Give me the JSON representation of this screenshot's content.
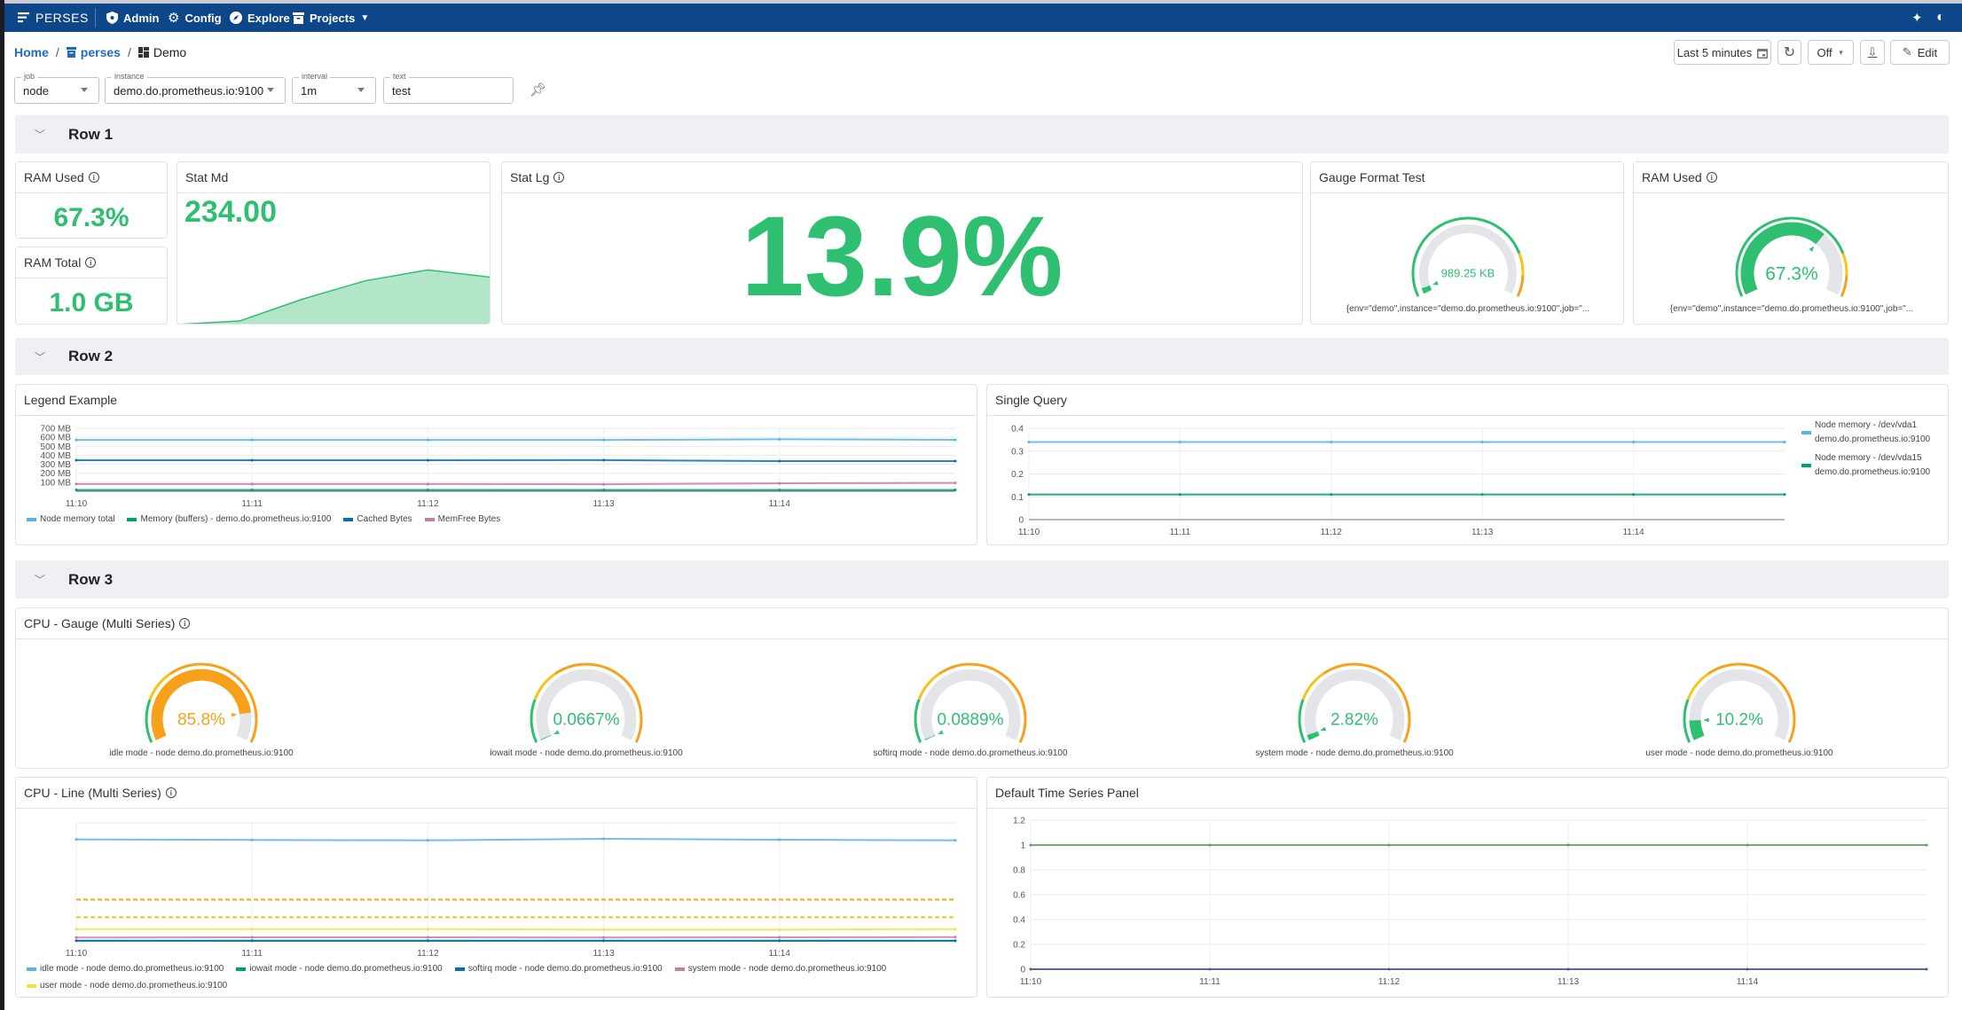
{
  "nav": {
    "brand": "PERSES",
    "items": [
      {
        "label": "Admin",
        "icon": "shield-icon"
      },
      {
        "label": "Config",
        "icon": "gear-icon"
      },
      {
        "label": "Explore",
        "icon": "compass-icon"
      },
      {
        "label": "Projects",
        "icon": "archive-icon"
      }
    ]
  },
  "breadcrumb": {
    "home": "Home",
    "project": "perses",
    "dashboard": "Demo"
  },
  "variables": [
    {
      "label": "job",
      "value": "node",
      "type": "select"
    },
    {
      "label": "instance",
      "value": "demo.do.prometheus.io:9100",
      "type": "select"
    },
    {
      "label": "interval",
      "value": "1m",
      "type": "select"
    },
    {
      "label": "text",
      "value": "test",
      "type": "text"
    }
  ],
  "toolbar": {
    "time_range": "Last 5 minutes",
    "refresh_interval": "Off",
    "edit_label": "Edit"
  },
  "colors": {
    "nav": "#0e4789",
    "green": "#2fbf71",
    "yellow": "#f6c417",
    "orange": "#f7a11a",
    "gauge_track": "#e3e5e8"
  },
  "rows": [
    {
      "title": "Row 1"
    },
    {
      "title": "Row 2"
    },
    {
      "title": "Row 3"
    }
  ],
  "row1": {
    "ram_used": {
      "title": "RAM Used",
      "value": "67.3%"
    },
    "ram_total": {
      "title": "RAM Total",
      "value": "1.0 GB"
    },
    "stat_md": {
      "title": "Stat Md",
      "value": "234.00",
      "sparkline": [
        0,
        0.03,
        0.21,
        0.36,
        0.45,
        0.39
      ]
    },
    "stat_lg": {
      "title": "Stat Lg",
      "value": "13.9%"
    },
    "gauge_format": {
      "title": "Gauge Format Test"
    },
    "ram_used_gauge": {
      "title": "RAM Used"
    }
  },
  "gauges": {
    "gauge_format": {
      "value": "989.25 KB",
      "fraction": 0.03,
      "label": "{env=\"demo\",instance=\"demo.do.prometheus.io:9100\",job=\"...",
      "thresholds": [
        {
          "from": 0,
          "color": "#2fbf71"
        },
        {
          "from": 0.8,
          "color": "#f6c417"
        },
        {
          "from": 0.9,
          "color": "#f7a11a"
        }
      ]
    },
    "ram_used": {
      "value": "67.3%",
      "fraction": 0.673,
      "label": "{env=\"demo\",instance=\"demo.do.prometheus.io:9100\",job=\"...",
      "thresholds": [
        {
          "from": 0,
          "color": "#2fbf71"
        },
        {
          "from": 0.8,
          "color": "#f6c417"
        },
        {
          "from": 0.9,
          "color": "#f7a11a"
        }
      ]
    },
    "cpu_title": "CPU - Gauge (Multi Series)",
    "cpu": [
      {
        "value": "85.8%",
        "fraction": 0.858,
        "label": "idle mode - node demo.do.prometheus.io:9100"
      },
      {
        "value": "0.0667%",
        "fraction": 0.000667,
        "label": "iowait mode - node demo.do.prometheus.io:9100"
      },
      {
        "value": "0.0889%",
        "fraction": 0.000889,
        "label": "softirq mode - node demo.do.prometheus.io:9100"
      },
      {
        "value": "2.82%",
        "fraction": 0.0282,
        "label": "system mode - node demo.do.prometheus.io:9100"
      },
      {
        "value": "10.2%",
        "fraction": 0.102,
        "label": "user mode - node demo.do.prometheus.io:9100"
      }
    ],
    "cpu_thresholds": [
      {
        "from": 0,
        "color": "#2fbf71"
      },
      {
        "from": 0.2,
        "color": "#f6c417"
      },
      {
        "from": 0.35,
        "color": "#f7a11a"
      }
    ]
  },
  "chart_data": [
    {
      "id": "legend_example",
      "title": "Legend Example",
      "type": "line",
      "x": [
        "11:10",
        "11:11",
        "11:12",
        "11:13",
        "11:14",
        "11:15"
      ],
      "xticks": [
        "11:10",
        "11:11",
        "11:12",
        "11:13",
        "11:14"
      ],
      "yticks": [
        100,
        200,
        300,
        400,
        500,
        600,
        700
      ],
      "ytick_labels": [
        "100 MB",
        "200 MB",
        "300 MB",
        "400 MB",
        "500 MB",
        "600 MB",
        "700 MB"
      ],
      "ylim": [
        0,
        700
      ],
      "yunit": "MB",
      "legend": "bottom",
      "grid": true,
      "series": [
        {
          "name": "Node memory total",
          "color": "#56b4e9",
          "values": [
            570,
            570,
            570,
            570,
            578,
            572
          ]
        },
        {
          "name": "Memory (buffers) - demo.do.prometheus.io:9100",
          "color": "#009e73",
          "values": [
            15,
            15,
            15,
            15,
            15,
            15
          ]
        },
        {
          "name": "Cached Bytes",
          "color": "#0072b2",
          "values": [
            345,
            345,
            345,
            346,
            335,
            335
          ]
        },
        {
          "name": "MemFree Bytes",
          "color": "#cc79a7",
          "values": [
            80,
            80,
            80,
            78,
            88,
            92
          ]
        }
      ]
    },
    {
      "id": "single_query",
      "title": "Single Query",
      "type": "line",
      "x": [
        "11:10",
        "11:11",
        "11:12",
        "11:13",
        "11:14",
        "11:15"
      ],
      "xticks": [
        "11:10",
        "11:11",
        "11:12",
        "11:13",
        "11:14"
      ],
      "yticks": [
        0,
        0.1,
        0.2,
        0.3,
        0.4
      ],
      "ytick_labels": [
        "0",
        "0.1",
        "0.2",
        "0.3",
        "0.4"
      ],
      "ylim": [
        0,
        0.4
      ],
      "legend": "right",
      "grid": true,
      "series": [
        {
          "name": "Node memory - /dev/vda1",
          "name2": "demo.do.prometheus.io:9100",
          "color": "#56b4e9",
          "values": [
            0.34,
            0.34,
            0.34,
            0.34,
            0.34,
            0.34
          ]
        },
        {
          "name": "Node memory - /dev/vda15",
          "name2": "demo.do.prometheus.io:9100",
          "color": "#009e73",
          "values": [
            0.11,
            0.11,
            0.11,
            0.11,
            0.11,
            0.11
          ]
        }
      ]
    },
    {
      "id": "cpu_line",
      "title": "CPU - Line (Multi Series)",
      "type": "line",
      "x": [
        "11:10",
        "11:11",
        "11:12",
        "11:13",
        "11:14",
        "11:15"
      ],
      "xticks": [
        "11:10",
        "11:11",
        "11:12",
        "11:13",
        "11:14"
      ],
      "yticks": [],
      "ytick_labels": [],
      "ylim": [
        0,
        1
      ],
      "legend": "bottom",
      "grid": true,
      "thresholds": [
        {
          "value": 0.35,
          "color": "#f7a11a"
        },
        {
          "value": 0.2,
          "color": "#f6c417"
        }
      ],
      "series": [
        {
          "name": "idle mode - node demo.do.prometheus.io:9100",
          "color": "#56b4e9",
          "values": [
            0.86,
            0.855,
            0.852,
            0.865,
            0.857,
            0.852
          ]
        },
        {
          "name": "iowait mode - node demo.do.prometheus.io:9100",
          "color": "#009e73",
          "values": [
            0.0007,
            0.0007,
            0.0007,
            0.0007,
            0.0007,
            0.0007
          ]
        },
        {
          "name": "softirq mode - node demo.do.prometheus.io:9100",
          "color": "#0072b2",
          "values": [
            0.0009,
            0.0009,
            0.0009,
            0.0009,
            0.0009,
            0.0009
          ]
        },
        {
          "name": "system mode - node demo.do.prometheus.io:9100",
          "color": "#cc79a7",
          "values": [
            0.028,
            0.03,
            0.03,
            0.028,
            0.03,
            0.032
          ]
        },
        {
          "name": "user mode - node demo.do.prometheus.io:9100",
          "color": "#f0e442",
          "values": [
            0.1,
            0.1,
            0.1,
            0.095,
            0.095,
            0.1
          ]
        }
      ]
    },
    {
      "id": "default_ts",
      "title": "Default Time Series Panel",
      "type": "line",
      "x": [
        "11:10",
        "11:11",
        "11:12",
        "11:13",
        "11:14",
        "11:15"
      ],
      "xticks": [
        "11:10",
        "11:11",
        "11:12",
        "11:13",
        "11:14"
      ],
      "yticks": [
        0,
        0.2,
        0.4,
        0.6,
        0.8,
        1,
        1.2
      ],
      "ytick_labels": [
        "0",
        "0.2",
        "0.4",
        "0.6",
        "0.8",
        "1",
        "1.2"
      ],
      "ylim": [
        0,
        1.2
      ],
      "legend": "none",
      "grid": true,
      "series": [
        {
          "color": "#5f9a63",
          "values": [
            1,
            1,
            1,
            1,
            1,
            1
          ]
        },
        {
          "color": "#4a5b8c",
          "values": [
            0,
            0,
            0,
            0,
            0,
            0
          ]
        }
      ]
    }
  ]
}
